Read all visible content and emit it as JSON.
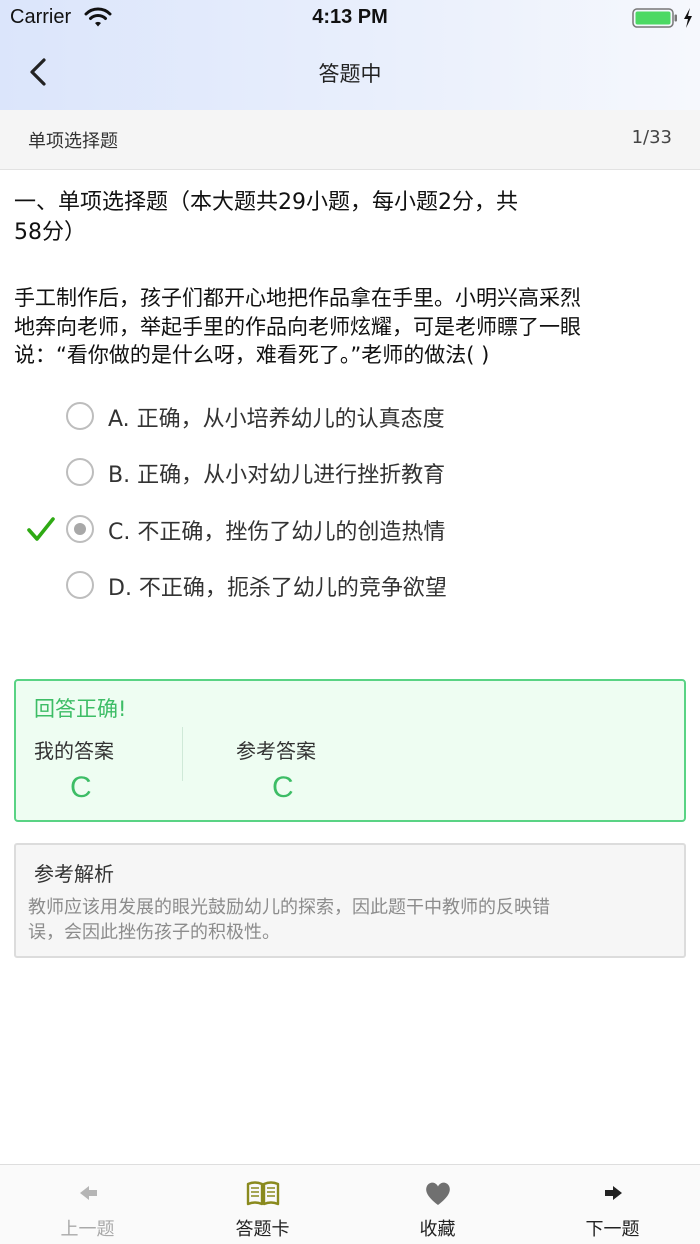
{
  "status_bar": {
    "carrier": "Carrier",
    "time": "4:13 PM"
  },
  "nav": {
    "title": "答题中",
    "back_icon": "chevron-left-icon"
  },
  "section": {
    "label": "单项选择题",
    "progress": "1/33"
  },
  "question": {
    "heading_line1": "一、单项选择题（本大题共29小题，每小题2分，共",
    "heading_line2": "58分）",
    "stem_line1": "手工制作后，孩子们都开心地把作品拿在手里。小明兴高采烈",
    "stem_line2": "地奔向老师，举起手里的作品向老师炫耀，可是老师瞟了一眼",
    "stem_line3": "说：“看你做的是什么呀，难看死了。”老师的做法(    )",
    "options": [
      {
        "label": "A. 正确，从小培养幼儿的认真态度",
        "selected": false
      },
      {
        "label": "B. 正确，从小对幼儿进行挫折教育",
        "selected": false
      },
      {
        "label": "C. 不正确，挫伤了幼儿的创造热情",
        "selected": true
      },
      {
        "label": "D. 不正确，扼杀了幼儿的竞争欲望",
        "selected": false
      }
    ]
  },
  "result": {
    "status": "回答正确!",
    "my_answer_label": "我的答案",
    "my_answer": "C",
    "ref_answer_label": "参考答案",
    "ref_answer": "C"
  },
  "analysis": {
    "title": "参考解析",
    "text_line1": "教师应该用发展的眼光鼓励幼儿的探索，因此题干中教师的反映错",
    "text_line2": "误，会因此挫伤孩子的积极性。"
  },
  "tabbar": {
    "items": [
      {
        "label": "上一题",
        "icon": "arrow-left-icon"
      },
      {
        "label": "答题卡",
        "icon": "book-icon"
      },
      {
        "label": "收藏",
        "icon": "heart-icon"
      },
      {
        "label": "下一题",
        "icon": "arrow-right-icon"
      }
    ]
  },
  "colors": {
    "correct_green": "#3dbd66",
    "check_green": "#2faa14",
    "nav_gradient_start": "#dbe5fb",
    "book_icon_olive": "#8a8a1e"
  }
}
